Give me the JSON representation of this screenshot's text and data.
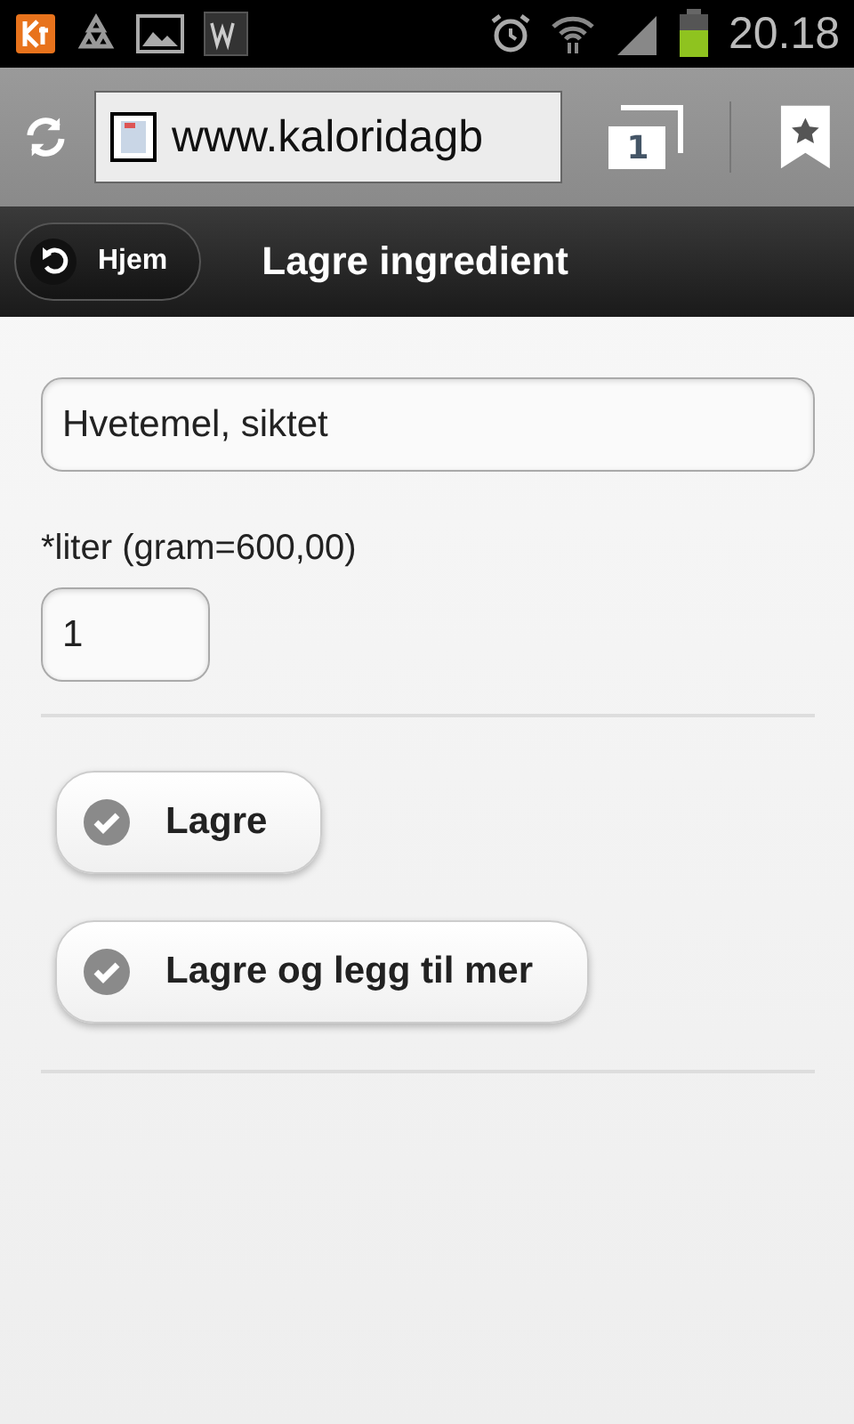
{
  "status_bar": {
    "time": "20.18"
  },
  "browser_bar": {
    "url": "www.kaloridagb",
    "tab_count": "1"
  },
  "header": {
    "back_button": "Hjem",
    "title": "Lagre ingredient"
  },
  "form": {
    "name_field": {
      "value": "Hvetemel, siktet"
    },
    "amount_label": "*liter (gram=600,00)",
    "amount_field": {
      "value": "1"
    }
  },
  "buttons": [
    {
      "label": "Lagre"
    },
    {
      "label": "Lagre og legg til mer"
    }
  ]
}
